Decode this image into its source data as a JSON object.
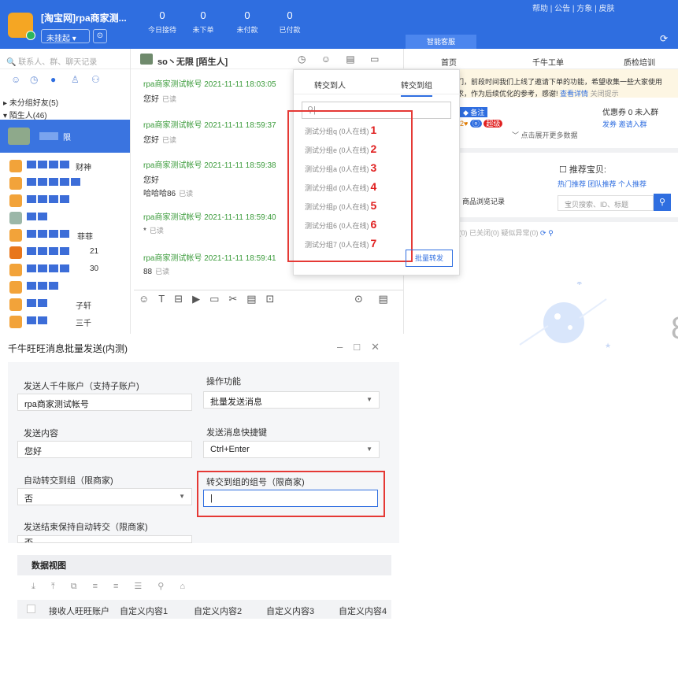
{
  "topbar": {
    "account_title": "[淘宝网]rpa商家测...",
    "status_label": "未挂起",
    "stats": [
      {
        "value": "0",
        "label": "今日接待"
      },
      {
        "value": "0",
        "label": "未下单"
      },
      {
        "value": "0",
        "label": "未付款"
      },
      {
        "value": "0",
        "label": "已付款"
      }
    ],
    "smart_tab": "智能客服",
    "links": "帮助 | 公告 | 方象 | 皮肤"
  },
  "contacts": {
    "search_placeholder": "联系人、群、聊天记录",
    "groups": [
      "未分组好友(5)",
      "陌生人(46)"
    ],
    "suffixes": [
      "财神",
      "",
      "",
      "",
      "菲菲",
      "21",
      "30",
      "",
      "子轩",
      "三千"
    ],
    "first_contact_suffix": "限"
  },
  "chat": {
    "name": "so丶无限 [陌生人]",
    "messages": [
      {
        "meta": "rpa商家测试帐号 2021-11-11 18:03:05",
        "lines": [
          "您好"
        ],
        "read": "已读"
      },
      {
        "meta": "rpa商家测试帐号 2021-11-11 18:59:37",
        "lines": [
          "您好"
        ],
        "read": "已读"
      },
      {
        "meta": "rpa商家测试帐号 2021-11-11 18:59:38",
        "lines": [
          "您好",
          "哈哈哈86"
        ],
        "read": "已读"
      },
      {
        "meta": "rpa商家测试帐号 2021-11-11 18:59:40",
        "lines": [
          "*"
        ],
        "read": "已读"
      },
      {
        "meta": "rpa商家测试帐号 2021-11-11 18:59:41",
        "lines": [
          "88"
        ],
        "read": "已读"
      }
    ]
  },
  "right_panel": {
    "tabs": [
      "首页",
      "千牛工单",
      "质检培训"
    ],
    "notice": "们，前段时间我们上线了邀请下单的功能，希望收集一些大家使用",
    "notice2": "求，作为后续优化的参考，感谢!",
    "notice_link": "查看详情",
    "notice_close": "关闭提示",
    "coupon": "优惠券 0 未入群",
    "coupon_links": "发券    邀请入群",
    "expand": "点击展开更多数据",
    "recommend_title": "推荐宝贝:",
    "recommend_links": "热门推荐  团队推荐  个人推荐",
    "goods_search_placeholder": "宝贝搜索、ID、标题",
    "browse_record": "商品浏览记录",
    "order_tabs": "待成功(0)    已完成(0)    已关闭(0)    疑似异常(0)",
    "remark_tag": "备注",
    "level_tag": "超级"
  },
  "transfer_popup": {
    "tab_person": "转交到人",
    "tab_group": "转交到组",
    "groups": [
      {
        "name": "测试分组q",
        "online": "(0人在线)",
        "num": "1"
      },
      {
        "name": "测试分组e",
        "online": "(0人在线)",
        "num": "2"
      },
      {
        "name": "测试分组a",
        "online": "(0人在线)",
        "num": "3"
      },
      {
        "name": "测试分组d",
        "online": "(0人在线)",
        "num": "4"
      },
      {
        "name": "测试分组p",
        "online": "(0人在线)",
        "num": "5"
      },
      {
        "name": "测试分组6",
        "online": "(0人在线)",
        "num": "6"
      },
      {
        "name": "测试分组7",
        "online": "(0人在线)",
        "num": "7"
      }
    ],
    "batch_button": "批量转发"
  },
  "dialog": {
    "title": "千牛旺旺消息批量发送(内测)",
    "sender_label": "发送人千牛账户（支持子账户)",
    "sender_value": "rpa商家测试帐号",
    "operation_label": "操作功能",
    "operation_value": "批量发送消息",
    "content_label": "发送内容",
    "content_value": "您好",
    "hotkey_label": "发送消息快捷键",
    "hotkey_value": "Ctrl+Enter",
    "auto_transfer_label": "自动转交到组（限商家)",
    "auto_transfer_value": "否",
    "group_no_label": "转交到组的组号（限商家)",
    "group_no_value": "",
    "keep_auto_label": "发送结束保持自动转交（限商家)",
    "keep_auto_value": "否",
    "view_title": "数据视图",
    "columns": [
      "接收人旺旺账户",
      "自定义内容1",
      "自定义内容2",
      "自定义内容3",
      "自定义内容4"
    ]
  }
}
